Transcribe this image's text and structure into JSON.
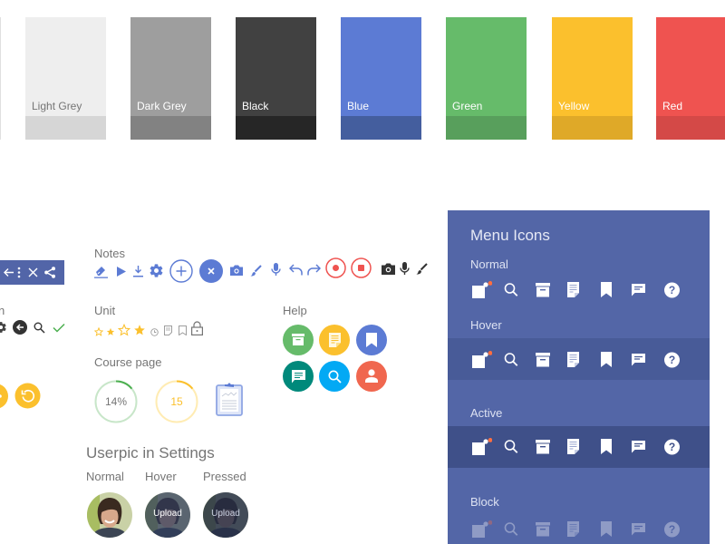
{
  "swatches": [
    {
      "label": "Light Grey",
      "main": "#eeeeee",
      "shade": "#d6d6d6",
      "text": "#757575"
    },
    {
      "label": "Dark Grey",
      "main": "#9e9e9e",
      "shade": "#828282",
      "text": "#ffffff"
    },
    {
      "label": "Black",
      "main": "#414141",
      "shade": "#262626",
      "text": "#ffffff"
    },
    {
      "label": "Blue",
      "main": "#5c7bd4",
      "shade": "#445e9e",
      "text": "#ffffff"
    },
    {
      "label": "Green",
      "main": "#66bb6a",
      "shade": "#589f5c",
      "text": "#ffffff"
    },
    {
      "label": "Yellow",
      "main": "#fbc02d",
      "shade": "#dfa928",
      "text": "#ffffff"
    },
    {
      "label": "Red",
      "main": "#ef5350",
      "shade": "#d44947",
      "text": "#ffffff"
    }
  ],
  "left_partial": {
    "toolbar_icons": [
      "arrow-left-icon",
      "more-vert-icon",
      "close-icon",
      "share-icon"
    ],
    "section_label_fragment": "n",
    "icons": [
      "gear-icon",
      "back-circle-icon",
      "search-icon",
      "check-icon"
    ],
    "yellow_buttons": [
      "partial-yellow-icon",
      "undo-icon"
    ]
  },
  "notes": {
    "label": "Notes",
    "icons": [
      "eraser-icon",
      "play-icon",
      "download-icon",
      "gear-icon",
      "add-circle-icon",
      "close-circle-icon",
      "camera-icon",
      "brush-icon",
      "mic-icon",
      "undo-icon",
      "redo-icon",
      "record-icon",
      "stop-icon",
      "camera-dark-icon",
      "mic-dark-icon",
      "brush-dark-icon"
    ]
  },
  "unit": {
    "label": "Unit",
    "icons": [
      "star-outline-small-icon",
      "star-filled-small-icon",
      "star-outline-icon",
      "star-filled-icon",
      "clock-icon",
      "note-icon",
      "bookmark-outline-icon",
      "lock-icon"
    ]
  },
  "help": {
    "label": "Help",
    "buttons": [
      {
        "icon": "archive-icon",
        "color": "#66bb6a"
      },
      {
        "icon": "document-icon",
        "color": "#fbc02d"
      },
      {
        "icon": "bookmark-icon",
        "color": "#5c7bd4"
      },
      {
        "icon": "chat-icon",
        "color": "#00897b"
      },
      {
        "icon": "search-icon",
        "color": "#03a9f4"
      },
      {
        "icon": "person-icon",
        "color": "#f0674f"
      }
    ]
  },
  "course_page": {
    "label": "Course page",
    "progress_percent": {
      "text": "14%",
      "value": 0.14,
      "color": "#4caf50",
      "track": "#c8e6c9"
    },
    "progress_count": {
      "text": "15",
      "value": 0.14,
      "color": "#fbc02d",
      "track": "#ffecb3"
    },
    "clipboard_icon": "clipboard-icon"
  },
  "userpic": {
    "title": "Userpic in Settings",
    "states": [
      {
        "label": "Normal",
        "overlay": ""
      },
      {
        "label": "Hover",
        "overlay": "Upload"
      },
      {
        "label": "Pressed",
        "overlay": "Upload"
      }
    ]
  },
  "menu_icons": {
    "title": "Menu Icons",
    "panel_color": "#5366a7",
    "states": [
      {
        "label": "Normal",
        "row_color": "",
        "opacity": 1
      },
      {
        "label": "Hover",
        "row_color": "#485b98",
        "opacity": 1
      },
      {
        "label": "Active",
        "row_color": "#3f5089",
        "opacity": 1
      },
      {
        "label": "Block",
        "row_color": "",
        "opacity": 0.35
      }
    ],
    "icons": [
      "notifications-icon",
      "search-icon",
      "archive-icon",
      "document-icon",
      "bookmark-icon",
      "chat-icon",
      "help-icon"
    ],
    "badge_color": "#ff6e40"
  }
}
